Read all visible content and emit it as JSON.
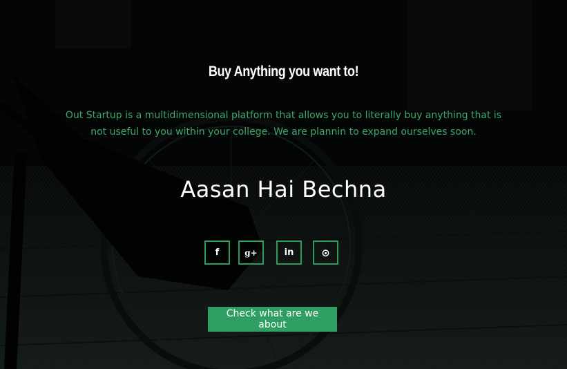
{
  "hero": {
    "headline": "Buy Anything you want to!",
    "description": "Out Startup is a multidimensional platform that allows you to literally buy anything that is not useful to you within your college. We are plannin to expand ourselves soon.",
    "brand": "Aasan Hai Bechna",
    "cta_label": "Check what are we about"
  },
  "social": [
    {
      "icon": "facebook-icon",
      "glyph": "f"
    },
    {
      "icon": "google-plus-icon",
      "glyph": "g+"
    },
    {
      "icon": "linkedin-icon",
      "glyph": "in"
    },
    {
      "icon": "github-icon",
      "glyph": "⊙"
    }
  ],
  "colors": {
    "accent": "#2e9e62",
    "description_text": "#3fa66b",
    "background": "#050706"
  }
}
